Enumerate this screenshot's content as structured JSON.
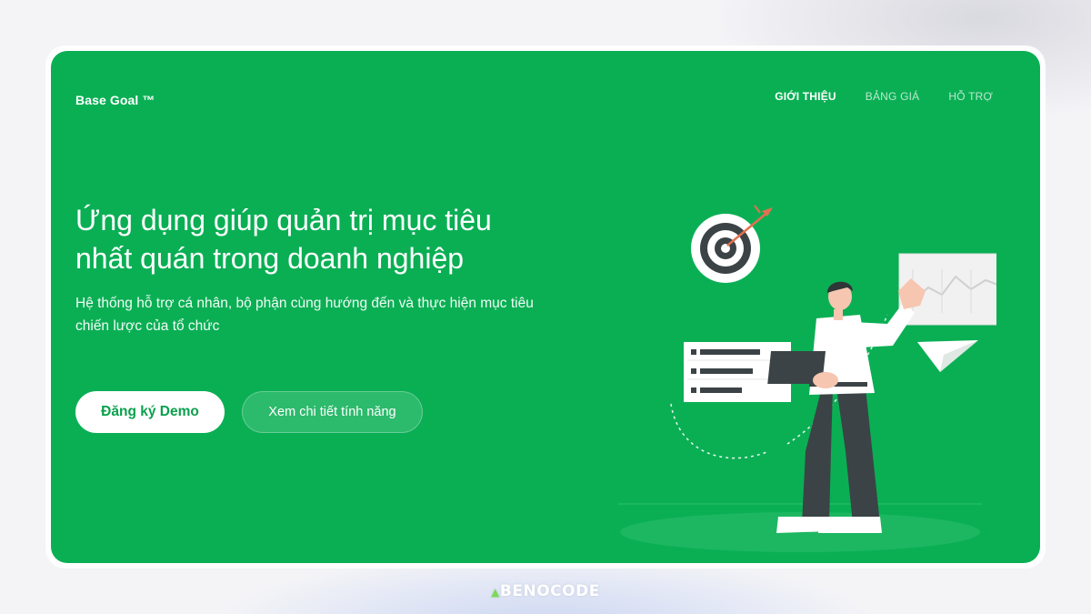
{
  "brand": {
    "name": "Base Goal ™"
  },
  "nav": {
    "items": [
      {
        "label": "GIỚI THIỆU",
        "active": true
      },
      {
        "label": "BẢNG GIÁ",
        "active": false
      },
      {
        "label": "HỖ TRỢ",
        "active": false
      }
    ]
  },
  "hero": {
    "headline_line1": "Ứng dụng giúp quản trị mục tiêu",
    "headline_line2": "nhất quán trong doanh nghiệp",
    "subline_line1": "Hệ thống hỗ trợ cá nhân, bộ phận cùng hướng đến và thực hiện mục tiêu",
    "subline_line2": "chiến lược của tổ chức",
    "primary_button": "Đăng ký Demo",
    "secondary_button": "Xem chi tiết tính năng"
  },
  "watermark": {
    "text": "BENOCODE"
  },
  "colors": {
    "brand_green": "#0aaf54",
    "button_text_green": "#0aa04c",
    "dark_pants": "#3b4346",
    "arrow_red": "#e2714f"
  }
}
